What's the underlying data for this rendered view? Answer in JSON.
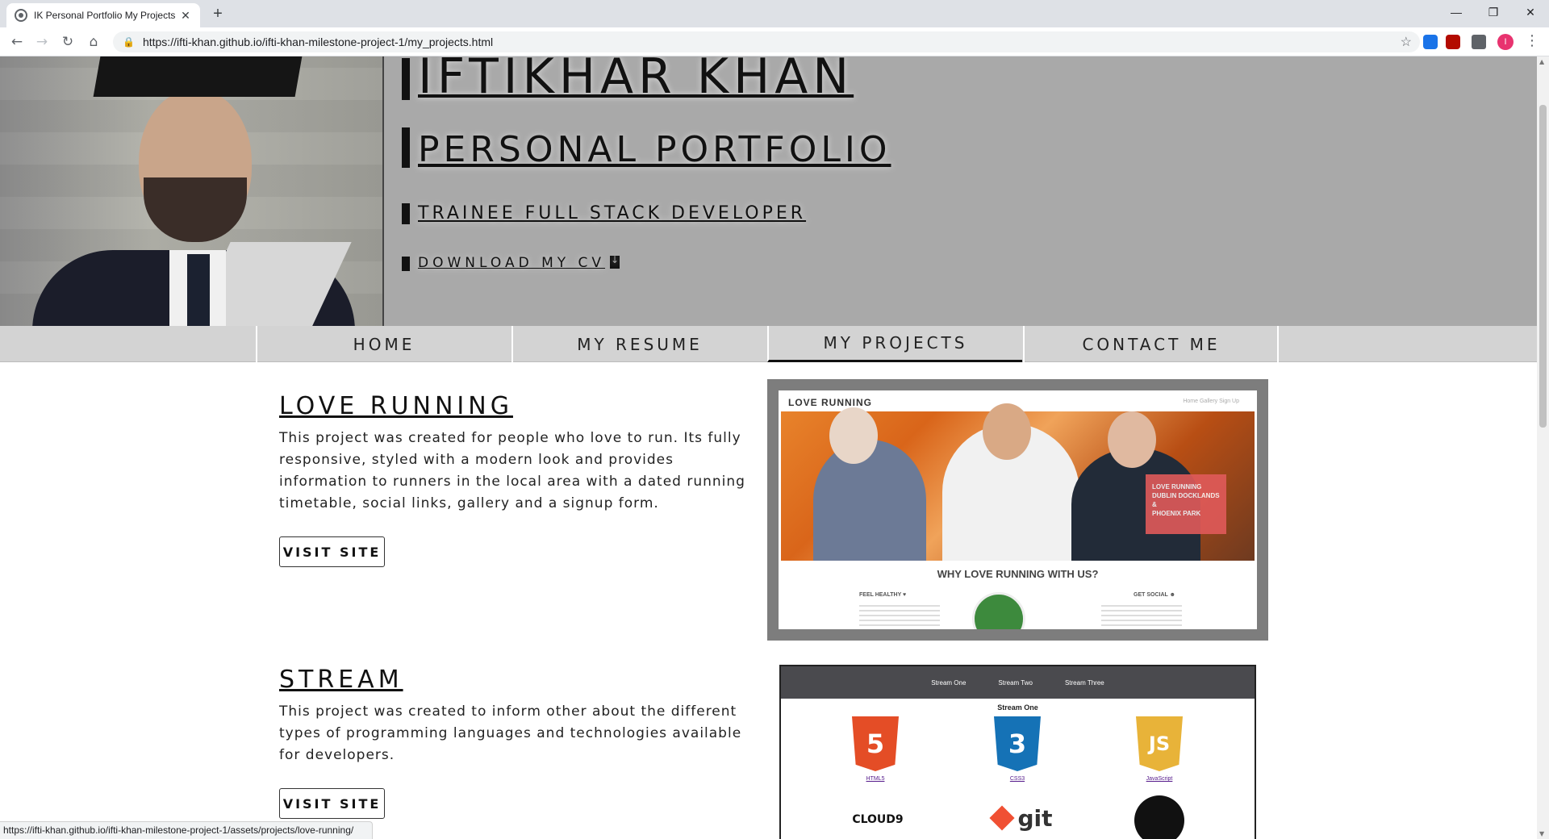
{
  "browser": {
    "tab_title": "IK Personal Portfolio My Projects",
    "tab_close": "✕",
    "new_tab": "+",
    "url": "https://ifti-khan.github.io/ifti-khan-milestone-project-1/my_projects.html",
    "window_controls": {
      "minimize": "—",
      "restore": "❐",
      "close": "✕"
    },
    "profile_initial": "I",
    "status_url": "https://ifti-khan.github.io/ifti-khan-milestone-project-1/assets/projects/love-running/"
  },
  "header": {
    "name": "IFTIKHAR KHAN",
    "subtitle": "PERSONAL PORTFOLIO",
    "role": "TRAINEE FULL STACK DEVELOPER",
    "download_cv": "DOWNLOAD MY CV"
  },
  "nav": {
    "items": [
      {
        "label": "HOME",
        "active": false
      },
      {
        "label": "MY RESUME",
        "active": false
      },
      {
        "label": "MY PROJECTS",
        "active": true
      },
      {
        "label": "CONTACT ME",
        "active": false
      }
    ]
  },
  "projects": [
    {
      "title": "LOVE RUNNING",
      "description": "This project was created for people who love to run. Its fully responsive, styled with a modern look and provides information to runners in the local area with a dated running timetable, social links, gallery and a signup form.",
      "button": "VISIT SITE",
      "screenshot": {
        "brand": "LOVE RUNNING",
        "nav": "Home   Gallery   Sign Up",
        "badge_line1": "LOVE RUNNING",
        "badge_line2": "DUBLIN DOCKLANDS &",
        "badge_line3": "PHOENIX PARK",
        "heading": "WHY LOVE RUNNING WITH US?",
        "col1": "FEEL HEALTHY ♥",
        "col2": "GET SOCIAL ☻"
      }
    },
    {
      "title": "STREAM",
      "description": "This project was created to inform other about the different types of programming languages and technologies available for developers.",
      "button": "VISIT SITE",
      "screenshot": {
        "nav": [
          "Stream One",
          "Stream Two",
          "Stream Three"
        ],
        "title": "Stream One",
        "logos": [
          {
            "label": "HTML5",
            "glyph": "5",
            "color": "#e44d26"
          },
          {
            "label": "CSS3",
            "glyph": "3",
            "color": "#1572b6"
          },
          {
            "label": "JavaScript",
            "glyph": "JS",
            "color": "#e8b339"
          }
        ],
        "cloud9": "CLOUD9",
        "git": "git"
      }
    }
  ]
}
